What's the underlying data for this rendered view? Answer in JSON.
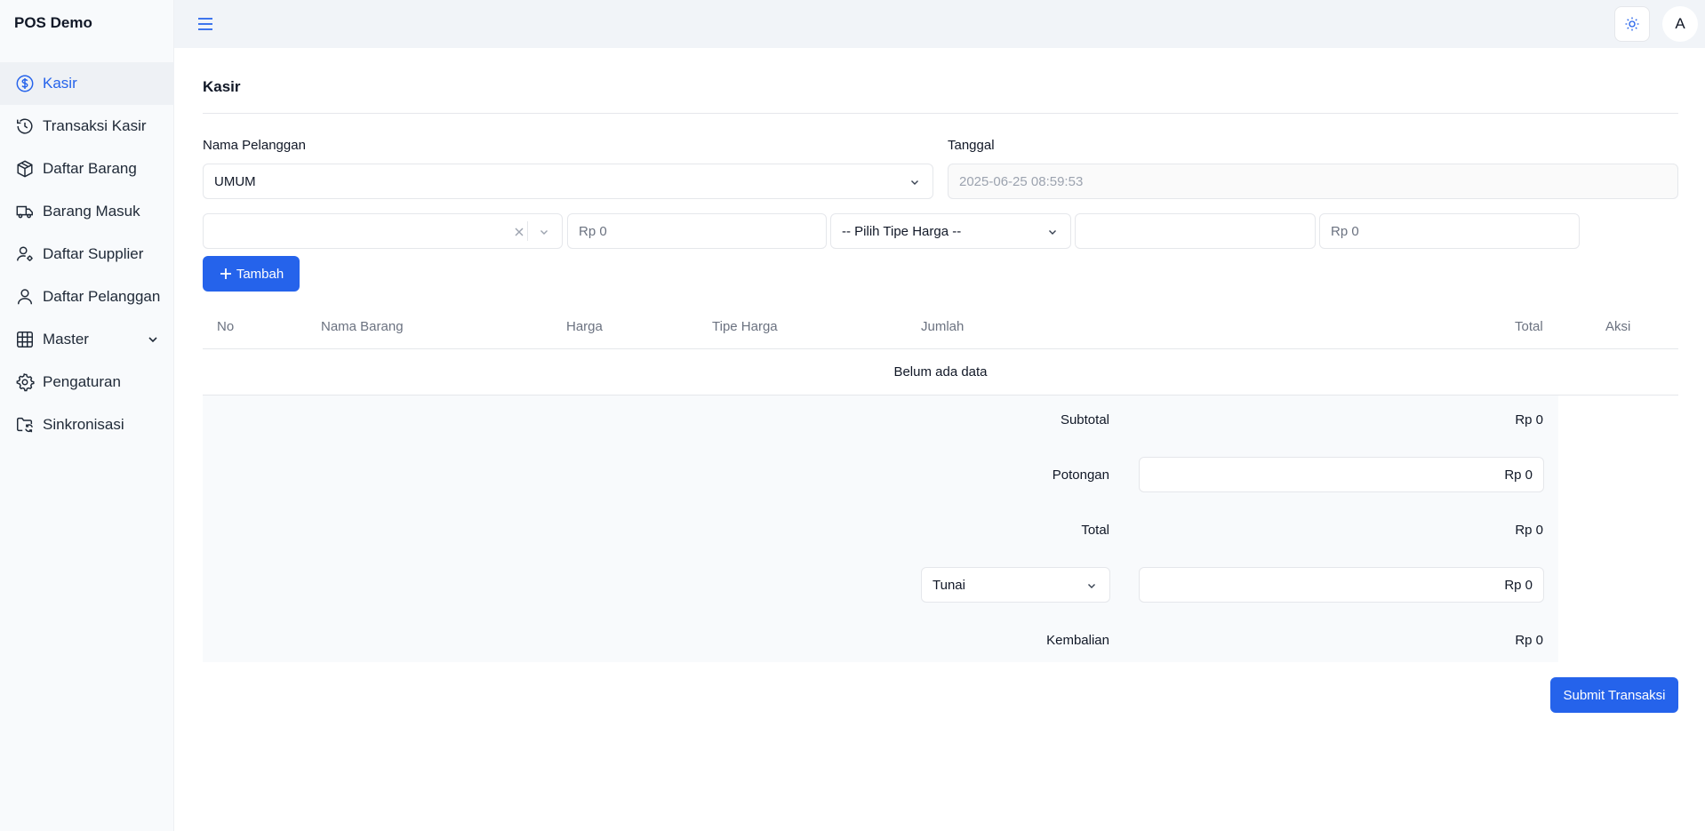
{
  "app": {
    "brand": "POS Demo"
  },
  "sidebar": {
    "items": [
      {
        "label": "Kasir",
        "icon": "dollar-circle-icon",
        "active": true
      },
      {
        "label": "Transaksi Kasir",
        "icon": "history-icon"
      },
      {
        "label": "Daftar Barang",
        "icon": "box-icon"
      },
      {
        "label": "Barang Masuk",
        "icon": "truck-icon"
      },
      {
        "label": "Daftar Supplier",
        "icon": "user-gear-icon"
      },
      {
        "label": "Daftar Pelanggan",
        "icon": "user-icon"
      },
      {
        "label": "Master",
        "icon": "grid-icon",
        "has_submenu": true
      },
      {
        "label": "Pengaturan",
        "icon": "gear-icon"
      },
      {
        "label": "Sinkronisasi",
        "icon": "folder-sync-icon"
      }
    ]
  },
  "topbar": {
    "avatar_initial": "A"
  },
  "page": {
    "title": "Kasir"
  },
  "form": {
    "customer_label": "Nama Pelanggan",
    "customer_value": "UMUM",
    "date_label": "Tanggal",
    "date_value": "2025-06-25 08:59:53",
    "price_placeholder": "Rp 0",
    "price_type_placeholder": "-- Pilih Tipe Harga --",
    "total_placeholder": "Rp 0",
    "add_button": "Tambah"
  },
  "table": {
    "headers": [
      "No",
      "Nama Barang",
      "Harga",
      "Tipe Harga",
      "Jumlah",
      "Total",
      "Aksi"
    ],
    "empty_text": "Belum ada data"
  },
  "summary": {
    "subtotal_label": "Subtotal",
    "subtotal_value": "Rp 0",
    "discount_label": "Potongan",
    "discount_value": "Rp 0",
    "total_label": "Total",
    "total_value": "Rp 0",
    "payment_method": "Tunai",
    "payment_value": "Rp 0",
    "change_label": "Kembalian",
    "change_value": "Rp 0"
  },
  "actions": {
    "submit": "Submit Transaksi"
  },
  "colors": {
    "primary": "#2563eb",
    "sidebar_bg": "#f8fafc",
    "topbar_bg": "#f1f4f8"
  }
}
